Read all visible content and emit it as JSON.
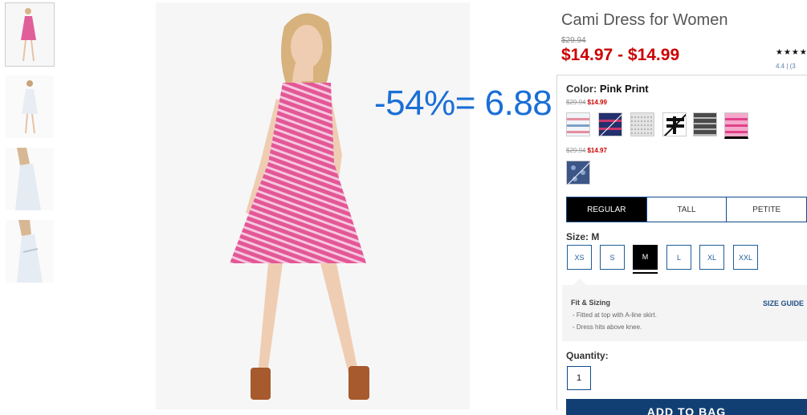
{
  "product": {
    "title": "Cami Dress for Women",
    "original_price": "$29.94",
    "sale_price": "$14.97 - $14.99",
    "stars": "★★★★",
    "rating": "4.4  |  (3"
  },
  "overlay": {
    "text": "-54%= 6.88"
  },
  "color": {
    "label": "Color:",
    "value": "Pink Print",
    "group1_original": "$29.94",
    "group1_sale": "$14.99",
    "group2_original": "$29.94",
    "group2_sale": "$14.97"
  },
  "fit_tabs": [
    "REGULAR",
    "TALL",
    "PETITE"
  ],
  "size": {
    "label": "Size:",
    "value": "M",
    "options": [
      "XS",
      "S",
      "M",
      "L",
      "XL",
      "XXL"
    ]
  },
  "fit_sizing": {
    "title": "Fit & Sizing",
    "size_guide": "SIZE GUIDE",
    "lines": [
      "- Fitted at top with A-line skirt.",
      "- Dress hits above knee."
    ]
  },
  "quantity": {
    "label": "Quantity:",
    "value": "1"
  },
  "add_to_bag": "ADD TO BAG",
  "colors": {
    "accent_red": "#cc0000",
    "tab_blue": "#0f4a8a",
    "button_navy": "#123f73",
    "overlay_blue": "#1a6fd6"
  }
}
